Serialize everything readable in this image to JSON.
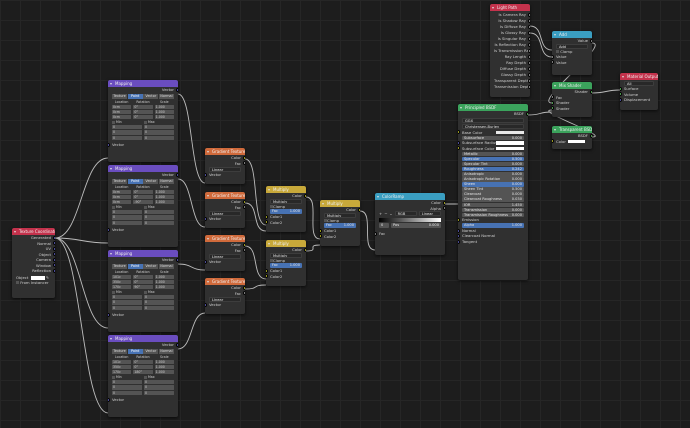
{
  "nodes": {
    "texcoord": {
      "title": "Texture Coordinate",
      "outputs": [
        "Generated",
        "Normal",
        "UV",
        "Object",
        "Camera",
        "Window",
        "Reflection"
      ],
      "object_label": "Object",
      "from_instancer": "From Instancer"
    },
    "mapping": {
      "title": "Mapping",
      "vector": "Vector",
      "tabs": [
        "Texture",
        "Point",
        "Vector",
        "Normal"
      ],
      "headers": [
        "Location",
        "Rotation",
        "Scale"
      ],
      "min": "Min",
      "max": "Max",
      "vector_out": "Vector"
    },
    "mapping_values": [
      {
        "active_tab": 1,
        "loc": [
          "0cm",
          "0cm",
          "0cm"
        ],
        "rot": [
          "0°",
          "0°",
          "0°"
        ],
        "scale": [
          "1.000",
          "1.000",
          "1.000"
        ]
      },
      {
        "active_tab": 1,
        "loc": [
          "0cm",
          "0cm",
          "0cm"
        ],
        "rot": [
          "0°",
          "0°",
          "-90°"
        ],
        "scale": [
          "1.000",
          "1.000",
          "1.000"
        ]
      },
      {
        "active_tab": 1,
        "loc": [
          "101c",
          "350c",
          "170c"
        ],
        "rot": [
          "0°",
          "0°",
          "90°"
        ],
        "scale": [
          "1.000",
          "1.000",
          "1.000"
        ]
      },
      {
        "active_tab": 1,
        "loc": [
          "101c",
          "350c",
          "170c"
        ],
        "rot": [
          "0°",
          "0°",
          "180°"
        ],
        "scale": [
          "1.000",
          "1.000",
          "1.000"
        ]
      }
    ],
    "mm_values": [
      "0",
      "0",
      "0",
      "0",
      "0",
      "0"
    ],
    "gradient": {
      "title": "Gradient Texture",
      "color": "Color",
      "fac": "Fac",
      "type": "Linear",
      "vector": "Vector"
    },
    "multiply": {
      "title": "Multiply",
      "color": "Color",
      "op": "Multiply",
      "clamp": "Clamp",
      "fac": "Fac",
      "fac_val": "1.000",
      "color1": "Color1",
      "color2": "Color2"
    },
    "colorramp": {
      "title": "ColorRamp",
      "color": "Color",
      "alpha": "Alpha",
      "rgb": "RGB",
      "linear": "Linear",
      "pos": "Pos",
      "pos_val": "0.000",
      "idx": "0",
      "fac": "Fac"
    },
    "bsdf": {
      "title": "Principled BSDF",
      "bsdf_out": "BSDF",
      "dist": "GGX",
      "sss_method": "Christensen-Burley",
      "rows": [
        [
          "Base Color",
          ""
        ],
        [
          "Subsurface",
          "0.000"
        ],
        [
          "Subsurface Radius",
          ""
        ],
        [
          "Subsurface Color",
          ""
        ],
        [
          "Metallic",
          "0.000"
        ],
        [
          "Specular",
          "0.500"
        ],
        [
          "Specular Tint",
          "0.000"
        ],
        [
          "Roughness",
          "0.242"
        ],
        [
          "Anisotropic",
          "0.000"
        ],
        [
          "Anisotropic Rotation",
          "0.000"
        ],
        [
          "Sheen",
          "0.000"
        ],
        [
          "Sheen Tint",
          "0.500"
        ],
        [
          "Clearcoat",
          "0.000"
        ],
        [
          "Clearcoat Roughness",
          "0.030"
        ],
        [
          "IOR",
          "1.450"
        ],
        [
          "Transmission",
          "0.000"
        ],
        [
          "Transmission Roughness",
          "0.000"
        ],
        [
          "Emission",
          ""
        ],
        [
          "Alpha",
          "1.000"
        ],
        [
          "Normal",
          ""
        ],
        [
          "Clearcoat Normal",
          ""
        ],
        [
          "Tangent",
          ""
        ]
      ]
    },
    "lightpath": {
      "title": "Light Path",
      "outputs": [
        "Is Camera Ray",
        "Is Shadow Ray",
        "Is Diffuse Ray",
        "Is Glossy Ray",
        "Is Singular Ray",
        "Is Reflection Ray",
        "Is Transmission Ray",
        "Ray Length",
        "Ray Depth",
        "Diffuse Depth",
        "Glossy Depth",
        "Transparent Depth",
        "Transmission Depth"
      ]
    },
    "add": {
      "title": "Add",
      "value": "Value",
      "op": "Add",
      "clamp": "Clamp",
      "v1": "Value",
      "v2": "Value"
    },
    "mixshader": {
      "title": "Mix Shader",
      "shader": "Shader",
      "fac": "Fac",
      "s1": "Shader",
      "s2": "Shader"
    },
    "transparent": {
      "title": "Transparent BSDF",
      "bsdf": "BSDF",
      "color": "Color"
    },
    "output": {
      "title": "Material Output",
      "target": "All",
      "surface": "Surface",
      "volume": "Volume",
      "displacement": "Displacement"
    }
  },
  "colors": {
    "texture": "#d06a3b",
    "converter": "#c8a93a",
    "vector": "#6a4dbf",
    "color_node": "#3a9ec1",
    "shader": "#3ba35c",
    "input": "#c4324c",
    "output": "#c4324c",
    "selected": "#4772b3"
  }
}
